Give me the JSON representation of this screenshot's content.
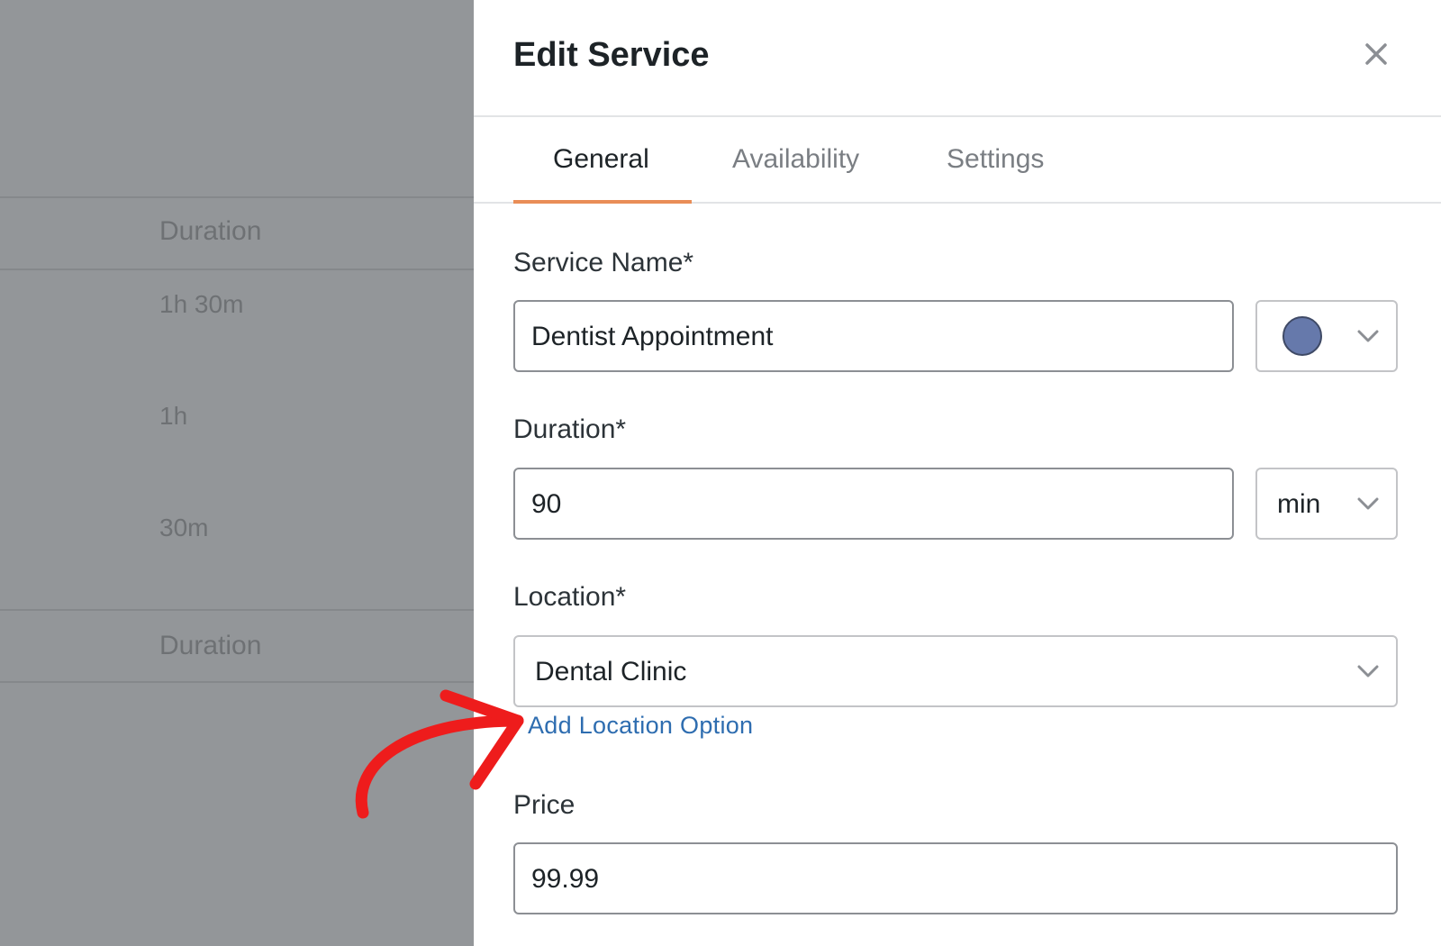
{
  "background_table": {
    "header_label": "Duration",
    "rows": [
      "1h 30m",
      "1h",
      "30m"
    ],
    "footer_label": "Duration"
  },
  "panel": {
    "title": "Edit Service",
    "close_icon": "close-icon"
  },
  "tabs": [
    {
      "label": "General",
      "active": true
    },
    {
      "label": "Availability",
      "active": false
    },
    {
      "label": "Settings",
      "active": false
    }
  ],
  "form": {
    "service_name": {
      "label": "Service Name*",
      "value": "Dentist Appointment",
      "color": "#6679ab"
    },
    "duration": {
      "label": "Duration*",
      "value": "90",
      "unit": "min"
    },
    "location": {
      "label": "Location*",
      "value": "Dental Clinic",
      "add_link": "Add Location Option"
    },
    "price": {
      "label": "Price",
      "value": "99.99"
    }
  },
  "annotation": {
    "arrow_color": "#ee1c1c"
  },
  "colors": {
    "tab_accent": "#e98d57",
    "link": "#2e6db0"
  }
}
